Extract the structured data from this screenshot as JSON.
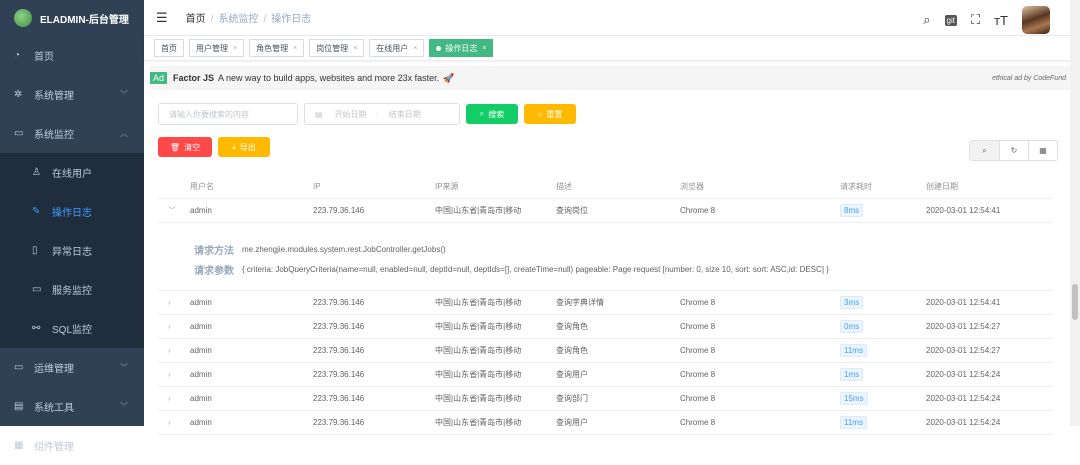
{
  "app": {
    "title": "ELADMIN-后台管理"
  },
  "sidebar": {
    "items": [
      {
        "label": "首页",
        "icon": "dashboard-icon"
      },
      {
        "label": "系统管理",
        "icon": "gear-icon"
      },
      {
        "label": "系统监控",
        "icon": "monitor-icon"
      },
      {
        "label": "运维管理",
        "icon": "ops-icon"
      },
      {
        "label": "系统工具",
        "icon": "toolbox-icon"
      },
      {
        "label": "组件管理",
        "icon": "component-icon"
      }
    ],
    "sub": [
      {
        "label": "在线用户"
      },
      {
        "label": "操作日志"
      },
      {
        "label": "异常日志"
      },
      {
        "label": "服务监控"
      },
      {
        "label": "SQL监控"
      }
    ]
  },
  "breadcrumb": [
    "首页",
    "系统监控",
    "操作日志"
  ],
  "tags": [
    "首页",
    "用户管理",
    "角色管理",
    "岗位管理",
    "在线用户",
    "操作日志"
  ],
  "ad": {
    "badge": "Ad",
    "brand": "Factor JS",
    "text": "A new way to build apps, websites and more 23x faster.",
    "right": "ethical ad by CodeFund"
  },
  "filters": {
    "search_placeholder": "请输入你要搜索的内容",
    "start_placeholder": "开始日期",
    "range_sep": ":",
    "end_placeholder": "结束日期",
    "search": "搜索",
    "reset": "重置"
  },
  "actions": {
    "clear": "清空",
    "export": "导出"
  },
  "table": {
    "headers": [
      "用户名",
      "IP",
      "IP来源",
      "描述",
      "浏览器",
      "请求耗时",
      "创建日期"
    ],
    "expanded": {
      "method_label": "请求方法",
      "method": "me.zhengjie.modules.system.rest.JobController.getJobs()",
      "params_label": "请求参数",
      "params": "{ criteria: JobQueryCriteria(name=null, enabled=null, deptId=null, deptIds=[], createTime=null) pageable: Page request [number: 0, size 10, sort: sort: ASC,id: DESC] }"
    },
    "rows": [
      [
        "admin",
        "223.79.36.146",
        "中国|山东省|青岛市|移动",
        "查询岗位",
        "Chrome 8",
        "8ms",
        "2020-03-01 12:54:41"
      ],
      [
        "admin",
        "223.79.36.146",
        "中国|山东省|青岛市|移动",
        "查询字典详情",
        "Chrome 8",
        "3ms",
        "2020-03-01 12:54:41"
      ],
      [
        "admin",
        "223.79.36.146",
        "中国|山东省|青岛市|移动",
        "查询角色",
        "Chrome 8",
        "0ms",
        "2020-03-01 12:54:27"
      ],
      [
        "admin",
        "223.79.36.146",
        "中国|山东省|青岛市|移动",
        "查询角色",
        "Chrome 8",
        "11ms",
        "2020-03-01 12:54:27"
      ],
      [
        "admin",
        "223.79.36.146",
        "中国|山东省|青岛市|移动",
        "查询用户",
        "Chrome 8",
        "1ms",
        "2020-03-01 12:54:24"
      ],
      [
        "admin",
        "223.79.36.146",
        "中国|山东省|青岛市|移动",
        "查询部门",
        "Chrome 8",
        "15ms",
        "2020-03-01 12:54:24"
      ],
      [
        "admin",
        "223.79.36.146",
        "中国|山东省|青岛市|移动",
        "查询用户",
        "Chrome 8",
        "11ms",
        "2020-03-01 12:54:24"
      ]
    ]
  }
}
